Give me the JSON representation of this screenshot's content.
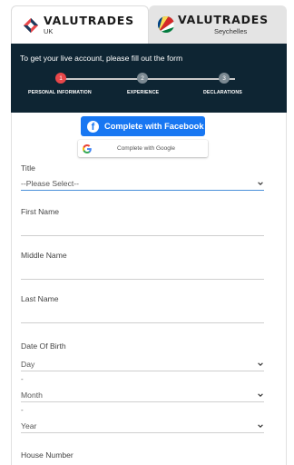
{
  "tabs": [
    {
      "name": "VALUTRADES",
      "sub": "UK"
    },
    {
      "name": "VALUTRADES",
      "sub": "Seychelles"
    }
  ],
  "header": {
    "title": "To get your live account, please fill out the form",
    "steps": [
      {
        "num": "1",
        "label": "PERSONAL INFORMATION"
      },
      {
        "num": "2",
        "label": "EXPERIENCE"
      },
      {
        "num": "3",
        "label": "DECLARATIONS"
      }
    ]
  },
  "social": {
    "facebook_label": "Complete with Facebook",
    "google_label": "Complete with Google"
  },
  "form": {
    "title_label": "Title",
    "title_value": "--Please Select--",
    "first_name_label": "First Name",
    "middle_name_label": "Middle Name",
    "last_name_label": "Last Name",
    "dob_label": "Date Of Birth",
    "dob_day": "Day",
    "dob_month": "Month",
    "dob_year": "Year",
    "separator": "-",
    "house_number_label": "House Number"
  },
  "colors": {
    "header_bg": "#0e2533",
    "active_step": "#e8474a",
    "inactive_step": "#7c8a93",
    "facebook": "#1877f2"
  }
}
